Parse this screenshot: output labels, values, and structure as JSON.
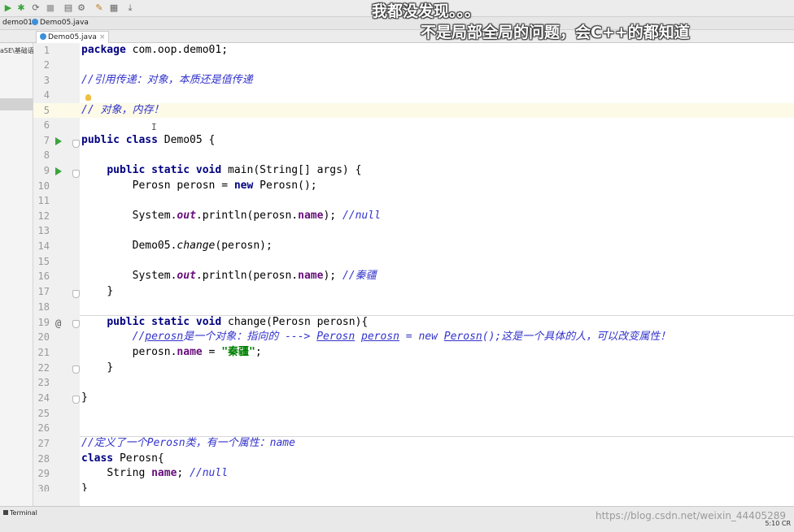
{
  "toolbar": {
    "icons": [
      "run-icon",
      "debug-icon",
      "coverage-icon",
      "stop-icon",
      "build-icon",
      "settings-icon",
      "structure-icon",
      "tool-icon",
      "update-icon"
    ]
  },
  "breadcrumb": {
    "module": "demo01",
    "file": "Demo05.java"
  },
  "editor_tab": {
    "label": "Demo05.java",
    "close": "×"
  },
  "project_panel": {
    "path": "aSE\\基础语"
  },
  "subtitles": {
    "line1": "我都没发现。。。",
    "line2": "不是局部全局的问题，会C++的都知道"
  },
  "code": {
    "line_numbers": [
      "1",
      "2",
      "3",
      "4",
      "5",
      "6",
      "7",
      "8",
      "9",
      "10",
      "11",
      "12",
      "13",
      "14",
      "15",
      "16",
      "17",
      "18",
      "19",
      "20",
      "21",
      "22",
      "23",
      "24",
      "25",
      "26",
      "27",
      "28",
      "29",
      "30"
    ],
    "l1_kw": "package",
    "l1_rest": " com.oop.demo01;",
    "l3": "//引用传递：对象，本质还是值传递",
    "l5": "// 对象，内存！",
    "l7_kw": "public class",
    "l7_rest": " Demo05 {",
    "l9_kw": "public static void",
    "l9_rest": " main(String[] args) {",
    "l10_a": "Perosn perosn = ",
    "l10_kw": "new",
    "l10_b": " Perosn();",
    "l12_a": "System.",
    "l12_out": "out",
    "l12_b": ".println(perosn.",
    "l12_name": "name",
    "l12_c": "); ",
    "l12_cm": "//null",
    "l14_a": "Demo05.",
    "l14_m": "change",
    "l14_b": "(perosn);",
    "l16_a": "System.",
    "l16_out": "out",
    "l16_b": ".println(perosn.",
    "l16_name": "name",
    "l16_c": "); ",
    "l16_cm": "//秦疆",
    "l17": "}",
    "l19_kw": "public static void",
    "l19_rest": " change(Perosn perosn){",
    "l20_a": "//",
    "l20_u1": "perosn",
    "l20_b": "是一个对象：指向的 ---> ",
    "l20_u2": "Perosn",
    "l20_c": " ",
    "l20_u3": "perosn",
    "l20_d": " = new ",
    "l20_u4": "Perosn",
    "l20_e": "();这是一个具体的人，可以改变属性！",
    "l21_a": "perosn.",
    "l21_name": "name",
    "l21_b": " = ",
    "l21_str": "\"秦疆\"",
    "l21_c": ";",
    "l22": "}",
    "l24": "}",
    "l27": "//定义了一个Perosn类，有一个属性：name",
    "l28_kw": "class",
    "l28_rest": " Perosn{",
    "l29_a": "String ",
    "l29_name": "name",
    "l29_b": "; ",
    "l29_cm": "//null",
    "l30": "}"
  },
  "bottom_bar": {
    "terminal_label": "Terminal",
    "watermark": "https://blog.csdn.net/weixin_44405289",
    "position": "5:10  CR"
  }
}
